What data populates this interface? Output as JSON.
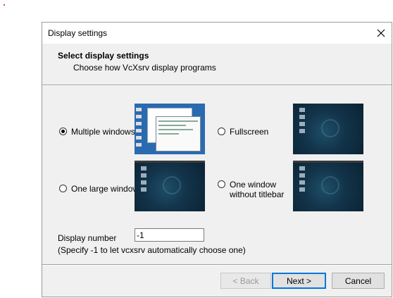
{
  "window": {
    "title": "Display settings",
    "close_glyph": "✕"
  },
  "header": {
    "title": "Select display settings",
    "subtitle": "Choose how VcXsrv display programs"
  },
  "options": [
    {
      "label": "Multiple windows",
      "checked": true
    },
    {
      "label": "Fullscreen",
      "checked": false
    },
    {
      "label": "One large window",
      "checked": false
    },
    {
      "label_line1": "One window",
      "label_line2": "without titlebar",
      "checked": false
    }
  ],
  "display_number": {
    "label": "Display number",
    "value": "-1",
    "hint": "(Specify -1 to let vcxsrv automatically choose one)"
  },
  "buttons": {
    "back": "< Back",
    "next": "Next >",
    "cancel": "Cancel"
  },
  "colors": {
    "accent": "#0078d7",
    "desktop_dark": "#123349",
    "desktop_windows": "#2a6ab0"
  }
}
